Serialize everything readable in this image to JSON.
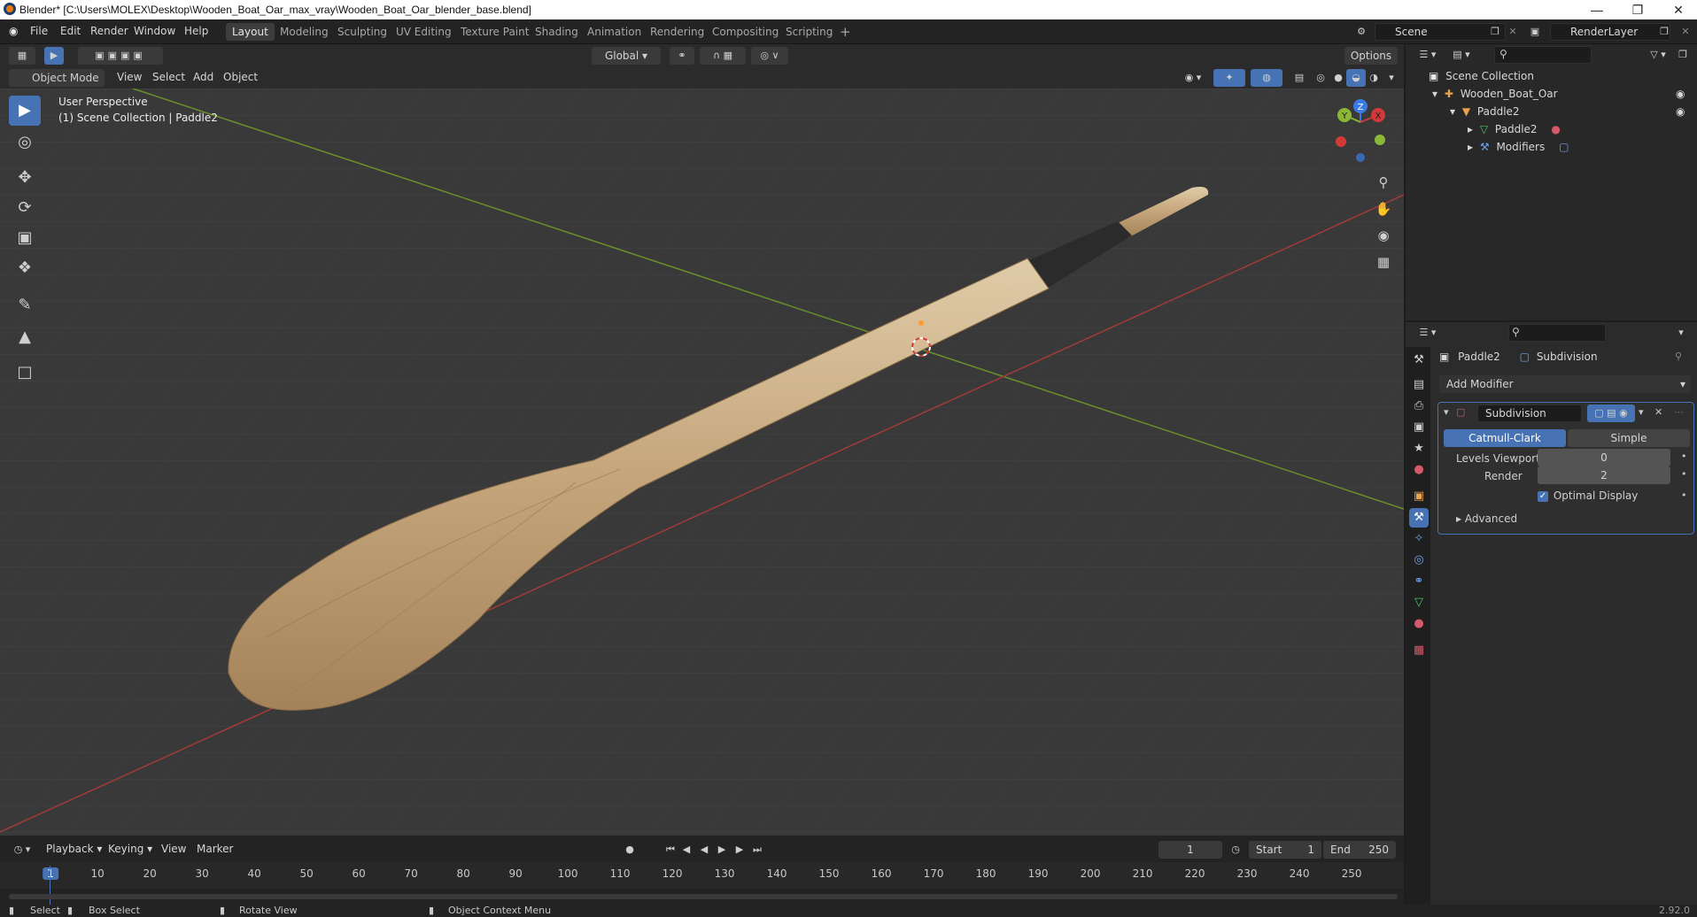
{
  "window": {
    "title": "Blender* [C:\\Users\\MOLEX\\Desktop\\Wooden_Boat_Oar_max_vray\\Wooden_Boat_Oar_blender_base.blend]"
  },
  "menu": [
    "File",
    "Edit",
    "Render",
    "Window",
    "Help"
  ],
  "workspaces": [
    "Layout",
    "Modeling",
    "Sculpting",
    "UV Editing",
    "Texture Paint",
    "Shading",
    "Animation",
    "Rendering",
    "Compositing",
    "Scripting"
  ],
  "active_workspace": "Layout",
  "scene_name": "Scene",
  "view_layer": "RenderLayer",
  "viewport_header": {
    "mode": "Object Mode",
    "menus": [
      "View",
      "Select",
      "Add",
      "Object"
    ],
    "transform_orientation": "Global",
    "options": "Options"
  },
  "viewport": {
    "perspective": "User Perspective",
    "collection_info": "(1) Scene Collection | Paddle2",
    "gizmo_axes": [
      "Z",
      "Y",
      "X"
    ]
  },
  "outliner": {
    "root": "Scene Collection",
    "items": [
      {
        "label": "Wooden_Boat_Oar",
        "icon": "empty-icon"
      },
      {
        "label": "Paddle2",
        "icon": "mesh-object-icon"
      },
      {
        "label": "Paddle2",
        "icon": "mesh-data-icon"
      },
      {
        "label": "Modifiers",
        "icon": "wrench-icon"
      }
    ]
  },
  "properties": {
    "breadcrumb_object": "Paddle2",
    "breadcrumb_modifier": "Subdivision",
    "add_modifier": "Add Modifier",
    "modifier": {
      "name": "Subdivision",
      "types": [
        "Catmull-Clark",
        "Simple"
      ],
      "active_type": "Catmull-Clark",
      "levels_viewport_label": "Levels Viewport",
      "levels_viewport": "0",
      "render_label": "Render",
      "render": "2",
      "optimal_display_label": "Optimal Display",
      "optimal_display": true,
      "advanced_label": "Advanced"
    }
  },
  "timeline": {
    "menus": [
      "Playback",
      "Keying",
      "View",
      "Marker"
    ],
    "current_frame": "1",
    "start_label": "Start",
    "start": "1",
    "end_label": "End",
    "end": "250",
    "ticks": [
      "1",
      "10",
      "20",
      "30",
      "40",
      "50",
      "60",
      "70",
      "80",
      "90",
      "100",
      "110",
      "120",
      "130",
      "140",
      "150",
      "160",
      "170",
      "180",
      "190",
      "200",
      "210",
      "220",
      "230",
      "240",
      "250"
    ]
  },
  "statusbar": {
    "select": "Select",
    "box_select": "Box Select",
    "rotate_view": "Rotate View",
    "context_menu": "Object Context Menu",
    "version": "2.92.0"
  },
  "colors": {
    "accent": "#4772b3",
    "x_axis": "#d23a3a",
    "y_axis": "#8ab735",
    "z_axis": "#3b7be8",
    "wood": "#c9ac85"
  }
}
